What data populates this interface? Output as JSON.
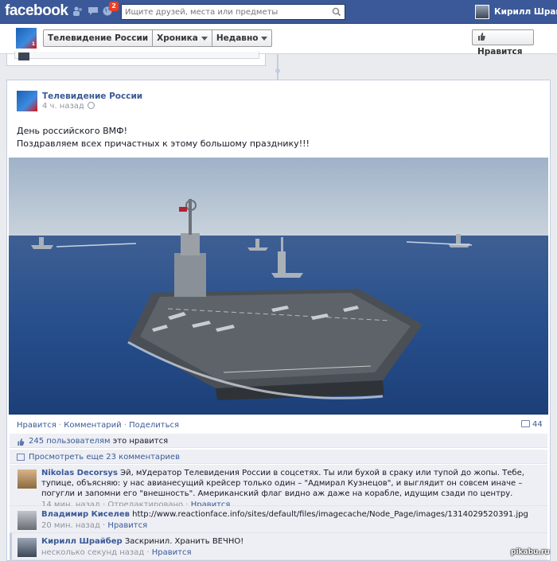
{
  "topbar": {
    "logo": "facebook",
    "notifications_count": "2",
    "search_placeholder": "Ищите друзей, места или предметы",
    "user_name": "Кирилл Шрайбер"
  },
  "page_header": {
    "crumbs": [
      "Телевидение России",
      "Хроника",
      "Недавно"
    ],
    "like_button": "Нравится"
  },
  "post": {
    "author": "Телевидение России",
    "time": "4 ч. назад",
    "text_lines": [
      "День российского ВМФ!",
      "Поздравляем всех причастных к этому большому празднику!!!"
    ],
    "actions": [
      "Нравится",
      "Комментарий",
      "Поделиться"
    ],
    "separator": "·",
    "comment_count": "44",
    "likes_count": "245 пользователям",
    "likes_rest": " это нравится",
    "view_more": "Просмотреть еще 23 комментариев"
  },
  "comments": [
    {
      "author": "Nikolas Decorsys",
      "text": " Эй, мУдератор Телевидения России в соцсетях. Ты или бухой в сраку или тупой до жопы. Тебе, тупице, объясняю: у нас авианесущий крейсер только один – \"Адмирал Кузнецов\", и выглядит он совсем иначе – погугли и запомни его \"внешность\". Американский флаг видно аж даже на корабле, идущим сзади по центру.",
      "time": "14 мин. назад",
      "edited": "Отредактировано",
      "like": "Нравится"
    },
    {
      "author": "Владимир Киселев",
      "text": " http://www.reactionface.info/sites/default/files/imagecache/Node_Page/images/1314029520391.jpg",
      "time": "20 мин. назад",
      "like": "Нравится"
    },
    {
      "author": "Кирилл Шрайбер",
      "text": " Заскринил. Хранить ВЕЧНО!",
      "time": "несколько секунд назад",
      "like": "Нравится"
    }
  ],
  "watermark": "pikabu.ru",
  "colors": {
    "brand_blue": "#3b5998",
    "background": "#e9ebee",
    "ufi_background": "#edeff4",
    "notification_red": "#f03d25"
  },
  "icons": [
    "friends-icon",
    "messages-icon",
    "globe-notifications-icon",
    "search-icon",
    "like-thumb-icon",
    "comment-bubble-icon"
  ]
}
